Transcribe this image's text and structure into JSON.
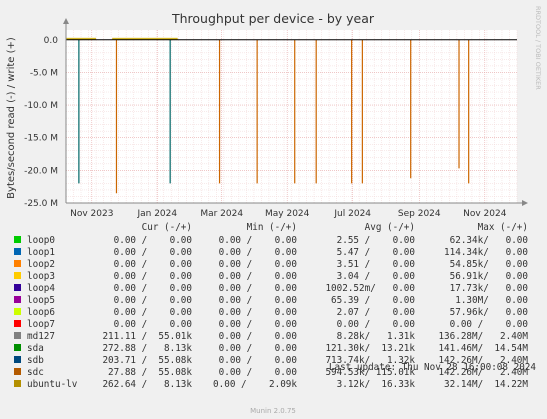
{
  "chart_data": {
    "type": "line",
    "title": "Throughput per device - by year",
    "ylabel": "Bytes/second read (-) / write (+)",
    "ylim": [
      -25000000,
      1500000
    ],
    "y_ticks": [
      {
        "value": 0,
        "label": "0.0"
      },
      {
        "value": -5000000,
        "label": "-5.0 M"
      },
      {
        "value": -10000000,
        "label": "-10.0 M"
      },
      {
        "value": -15000000,
        "label": "-15.0 M"
      },
      {
        "value": -20000000,
        "label": "-20.0 M"
      },
      {
        "value": -25000000,
        "label": "-25.0 M"
      }
    ],
    "xlim": [
      "2023-10-08",
      "2024-12-01"
    ],
    "x_ticks": [
      {
        "date": "2023-11-01",
        "label": "Nov 2023"
      },
      {
        "date": "2024-01-01",
        "label": "Jan 2024"
      },
      {
        "date": "2024-03-01",
        "label": "Mar 2024"
      },
      {
        "date": "2024-05-01",
        "label": "May 2024"
      },
      {
        "date": "2024-07-01",
        "label": "Jul 2024"
      },
      {
        "date": "2024-09-01",
        "label": "Sep 2024"
      },
      {
        "date": "2024-11-01",
        "label": "Nov 2024"
      }
    ],
    "grid": true,
    "series": [
      {
        "name": "sdb",
        "color": "#006666",
        "spikes": [
          {
            "date": "2023-10-20",
            "value": -22000000
          },
          {
            "date": "2024-01-13",
            "value": -22000000
          }
        ]
      },
      {
        "name": "sdc",
        "color": "#cc6600",
        "spikes": [
          {
            "date": "2023-11-24",
            "value": -23500000
          },
          {
            "date": "2024-02-28",
            "value": -22000000
          },
          {
            "date": "2024-04-03",
            "value": -22000000
          },
          {
            "date": "2024-05-08",
            "value": -22000000
          },
          {
            "date": "2024-05-28",
            "value": -22000000
          },
          {
            "date": "2024-06-30",
            "value": -22000000
          },
          {
            "date": "2024-07-10",
            "value": -22000000
          },
          {
            "date": "2024-08-24",
            "value": -21200000
          },
          {
            "date": "2024-10-08",
            "value": -19700000
          },
          {
            "date": "2024-10-17",
            "value": -22000000
          }
        ]
      },
      {
        "name": "ubuntu-lv",
        "color": "#ccaa00",
        "band": [
          {
            "from": "2023-10-08",
            "to": "2023-11-05",
            "value": 300000
          },
          {
            "from": "2023-11-20",
            "to": "2024-01-20",
            "value": 300000
          }
        ]
      }
    ]
  },
  "legend": {
    "header": {
      "cur": "Cur (-/+)",
      "min": "Min (-/+)",
      "avg": "Avg (-/+)",
      "max": "Max (-/+)"
    },
    "rows": [
      {
        "name": "loop0",
        "color": "#00cc00",
        "cur": "0.00 /    0.00",
        "min": "0.00 /    0.00",
        "avg": "2.55 /    0.00",
        "max": "62.34k/   0.00"
      },
      {
        "name": "loop1",
        "color": "#0066b3",
        "cur": "0.00 /    0.00",
        "min": "0.00 /    0.00",
        "avg": "5.47 /    0.00",
        "max": "114.34k/   0.00"
      },
      {
        "name": "loop2",
        "color": "#ff8000",
        "cur": "0.00 /    0.00",
        "min": "0.00 /    0.00",
        "avg": "3.51 /    0.00",
        "max": "54.85k/   0.00"
      },
      {
        "name": "loop3",
        "color": "#ffcc00",
        "cur": "0.00 /    0.00",
        "min": "0.00 /    0.00",
        "avg": "3.04 /    0.00",
        "max": "56.91k/   0.00"
      },
      {
        "name": "loop4",
        "color": "#330099",
        "cur": "0.00 /    0.00",
        "min": "0.00 /    0.00",
        "avg": "1002.52m/   0.00",
        "max": "17.73k/   0.00"
      },
      {
        "name": "loop5",
        "color": "#990099",
        "cur": "0.00 /    0.00",
        "min": "0.00 /    0.00",
        "avg": "65.39 /    0.00",
        "max": "1.30M/   0.00"
      },
      {
        "name": "loop6",
        "color": "#ccff00",
        "cur": "0.00 /    0.00",
        "min": "0.00 /    0.00",
        "avg": "2.07 /    0.00",
        "max": "57.96k/   0.00"
      },
      {
        "name": "loop7",
        "color": "#ff0000",
        "cur": "0.00 /    0.00",
        "min": "0.00 /    0.00",
        "avg": "0.00 /    0.00",
        "max": "0.00 /    0.00"
      },
      {
        "name": "md127",
        "color": "#808080",
        "cur": "211.11 /  55.01k",
        "min": "0.00 /    0.00",
        "avg": "8.28k/   1.31k",
        "max": "136.28M/   2.40M"
      },
      {
        "name": "sda",
        "color": "#008f00",
        "cur": "272.88 /   8.13k",
        "min": "0.00 /    0.00",
        "avg": "121.30k/  13.21k",
        "max": "141.46M/  14.54M"
      },
      {
        "name": "sdb",
        "color": "#00487d",
        "cur": "203.71 /  55.08k",
        "min": "0.00 /    0.00",
        "avg": "713.74k/   1.32k",
        "max": "142.26M/   2.40M"
      },
      {
        "name": "sdc",
        "color": "#b35a00",
        "cur": "27.88 /  55.08k",
        "min": "0.00 /    0.00",
        "avg": "594.53k/ 115.01k",
        "max": "142.26M/   2.40M"
      },
      {
        "name": "ubuntu-lv",
        "color": "#b38f00",
        "cur": "262.64 /   8.13k",
        "min": "0.00 /    2.09k",
        "avg": "3.12k/  16.33k",
        "max": "32.14M/  14.22M"
      }
    ]
  },
  "last_update": "Last update: Thu Nov 28 16:00:08 2024",
  "watermark": "RRDTOOL / TOBI OETIKER",
  "footer": "Munin 2.0.75"
}
